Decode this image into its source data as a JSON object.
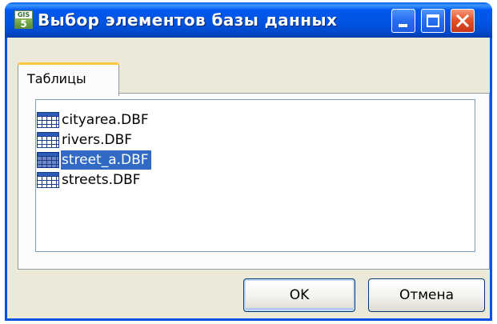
{
  "window": {
    "title": "Выбор элементов базы данных",
    "app_icon_text_top": "GIS",
    "app_icon_text_bottom": "5"
  },
  "tabs": [
    {
      "label": "Таблицы",
      "active": true
    }
  ],
  "list": {
    "items": [
      {
        "label": "cityarea.DBF",
        "icon": "table-icon",
        "selected": false
      },
      {
        "label": "rivers.DBF",
        "icon": "table-icon",
        "selected": false
      },
      {
        "label": "street_a.DBF",
        "icon": "table-icon",
        "selected": true
      },
      {
        "label": "streets.DBF",
        "icon": "table-icon",
        "selected": false
      }
    ]
  },
  "buttons": {
    "ok_label": "OK",
    "cancel_label": "Отмена"
  },
  "colors": {
    "titlebar": "#0054e3",
    "selection": "#316ac5",
    "dialog_bg": "#ece9d8",
    "tab_highlight": "#ffc83c"
  }
}
